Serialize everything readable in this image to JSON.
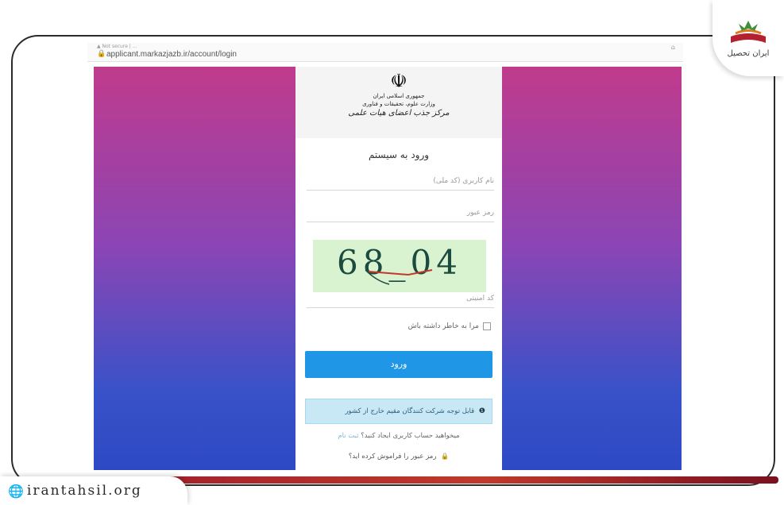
{
  "browser": {
    "url": "applicant.markazjazb.ir/account/login",
    "breadcrumb": "▲ Not secure | ..."
  },
  "header": {
    "emblem": "☫",
    "line1": "جمهوری اسلامی ایران",
    "line2": "وزارت علوم، تحقیقات و فناوری",
    "line3": "مرکز جذب اعضای هیات علمی"
  },
  "login": {
    "title": "ورود به سیستم",
    "username_placeholder": "نام کاربری (کد ملی)",
    "password_placeholder": "رمز عبور",
    "captcha_text": "68_04",
    "captcha_placeholder": "کد امنیتی",
    "remember_label": "مرا به خاطر داشته باش",
    "submit_label": "ورود",
    "notice": "قابل توجه شرکت کنندگان مقیم خارج از کشور",
    "signup_prompt": "میخواهید حساب کاربری ایجاد کنید؟",
    "signup_link": "ثبت نام",
    "forgot": "رمز عبور را فراموش کرده اید؟"
  },
  "branding": {
    "logo_text": "ایران تحصیل",
    "site": "irantahsil.org"
  },
  "colors": {
    "accent": "#1f97e6",
    "notice_bg": "#c9e8f6",
    "brand_red": "#a31d2c"
  }
}
